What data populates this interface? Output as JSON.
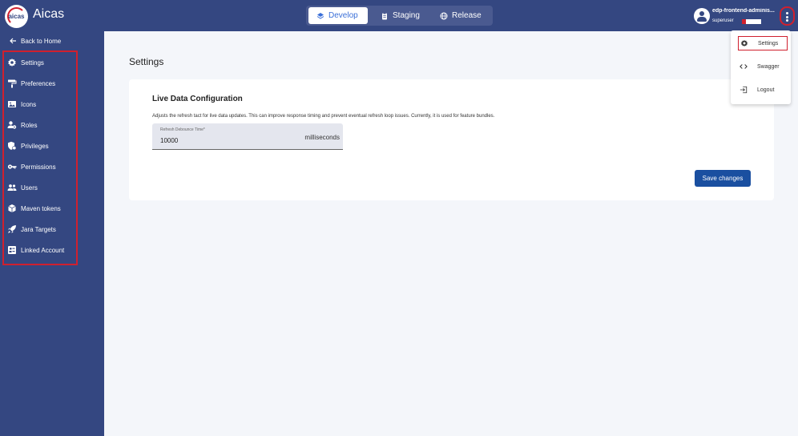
{
  "app": {
    "name": "Aicas",
    "logo_text": "aicas"
  },
  "environments": [
    {
      "label": "Develop",
      "icon": "layers-icon",
      "active": true
    },
    {
      "label": "Staging",
      "icon": "clipboard-icon",
      "active": false
    },
    {
      "label": "Release",
      "icon": "globe-icon",
      "active": false
    }
  ],
  "user": {
    "name": "edp-frontend-adminis...",
    "role": "superuser"
  },
  "sidebar": {
    "back_label": "Back to Home",
    "items": [
      {
        "label": "Settings",
        "icon": "gear-icon"
      },
      {
        "label": "Preferences",
        "icon": "paint-roller-icon"
      },
      {
        "label": "Icons",
        "icon": "image-icon"
      },
      {
        "label": "Roles",
        "icon": "user-cog-icon"
      },
      {
        "label": "Privileges",
        "icon": "shield-gear-icon"
      },
      {
        "label": "Permissions",
        "icon": "key-icon"
      },
      {
        "label": "Users",
        "icon": "users-icon"
      },
      {
        "label": "Maven tokens",
        "icon": "cube-icon"
      },
      {
        "label": "Jara Targets",
        "icon": "rocket-icon"
      },
      {
        "label": "Linked Account",
        "icon": "linked-account-icon"
      }
    ]
  },
  "main": {
    "title": "Settings",
    "card": {
      "title": "Live Data Configuration",
      "description": "Adjusts the refresh tact for live data updates. This can improve response timing and prevent eventual refresh loop issues. Currently, it is used for feature bundles.",
      "field_label": "Refresh Debounce Time*",
      "field_value": "10000",
      "field_suffix": "milliseconds",
      "save_label": "Save changes"
    }
  },
  "menu": {
    "items": [
      {
        "label": "Settings",
        "icon": "gear-icon"
      },
      {
        "label": "Swagger",
        "icon": "code-icon"
      },
      {
        "label": "Logout",
        "icon": "logout-icon"
      }
    ]
  },
  "colors": {
    "primary": "#344781",
    "accent": "#1a4fa0",
    "highlight": "#d0202e"
  }
}
